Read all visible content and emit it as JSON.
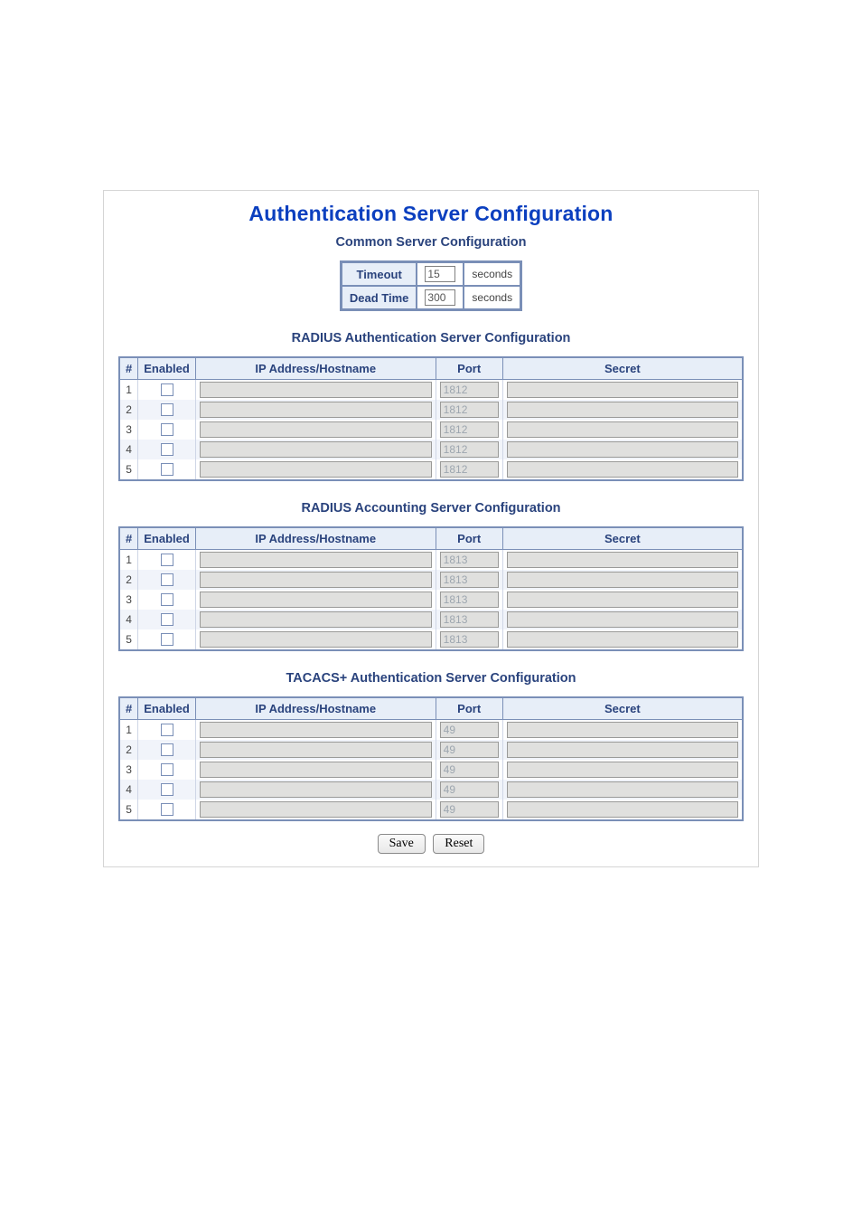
{
  "page_title": "Authentication Server Configuration",
  "common": {
    "title": "Common Server Configuration",
    "rows": [
      {
        "label": "Timeout",
        "value": "15",
        "unit": "seconds"
      },
      {
        "label": "Dead Time",
        "value": "300",
        "unit": "seconds"
      }
    ]
  },
  "headers": {
    "num": "#",
    "enabled": "Enabled",
    "host": "IP Address/Hostname",
    "port": "Port",
    "secret": "Secret"
  },
  "sections": [
    {
      "id": "radius_auth",
      "title": "RADIUS Authentication Server Configuration",
      "rows": [
        {
          "num": "1",
          "enabled": false,
          "host": "",
          "port": "1812",
          "secret": ""
        },
        {
          "num": "2",
          "enabled": false,
          "host": "",
          "port": "1812",
          "secret": ""
        },
        {
          "num": "3",
          "enabled": false,
          "host": "",
          "port": "1812",
          "secret": ""
        },
        {
          "num": "4",
          "enabled": false,
          "host": "",
          "port": "1812",
          "secret": ""
        },
        {
          "num": "5",
          "enabled": false,
          "host": "",
          "port": "1812",
          "secret": ""
        }
      ]
    },
    {
      "id": "radius_acct",
      "title": "RADIUS Accounting Server Configuration",
      "rows": [
        {
          "num": "1",
          "enabled": false,
          "host": "",
          "port": "1813",
          "secret": ""
        },
        {
          "num": "2",
          "enabled": false,
          "host": "",
          "port": "1813",
          "secret": ""
        },
        {
          "num": "3",
          "enabled": false,
          "host": "",
          "port": "1813",
          "secret": ""
        },
        {
          "num": "4",
          "enabled": false,
          "host": "",
          "port": "1813",
          "secret": ""
        },
        {
          "num": "5",
          "enabled": false,
          "host": "",
          "port": "1813",
          "secret": ""
        }
      ]
    },
    {
      "id": "tacacs_auth",
      "title": "TACACS+ Authentication Server Configuration",
      "rows": [
        {
          "num": "1",
          "enabled": false,
          "host": "",
          "port": "49",
          "secret": ""
        },
        {
          "num": "2",
          "enabled": false,
          "host": "",
          "port": "49",
          "secret": ""
        },
        {
          "num": "3",
          "enabled": false,
          "host": "",
          "port": "49",
          "secret": ""
        },
        {
          "num": "4",
          "enabled": false,
          "host": "",
          "port": "49",
          "secret": ""
        },
        {
          "num": "5",
          "enabled": false,
          "host": "",
          "port": "49",
          "secret": ""
        }
      ]
    }
  ],
  "buttons": {
    "save": "Save",
    "reset": "Reset"
  }
}
